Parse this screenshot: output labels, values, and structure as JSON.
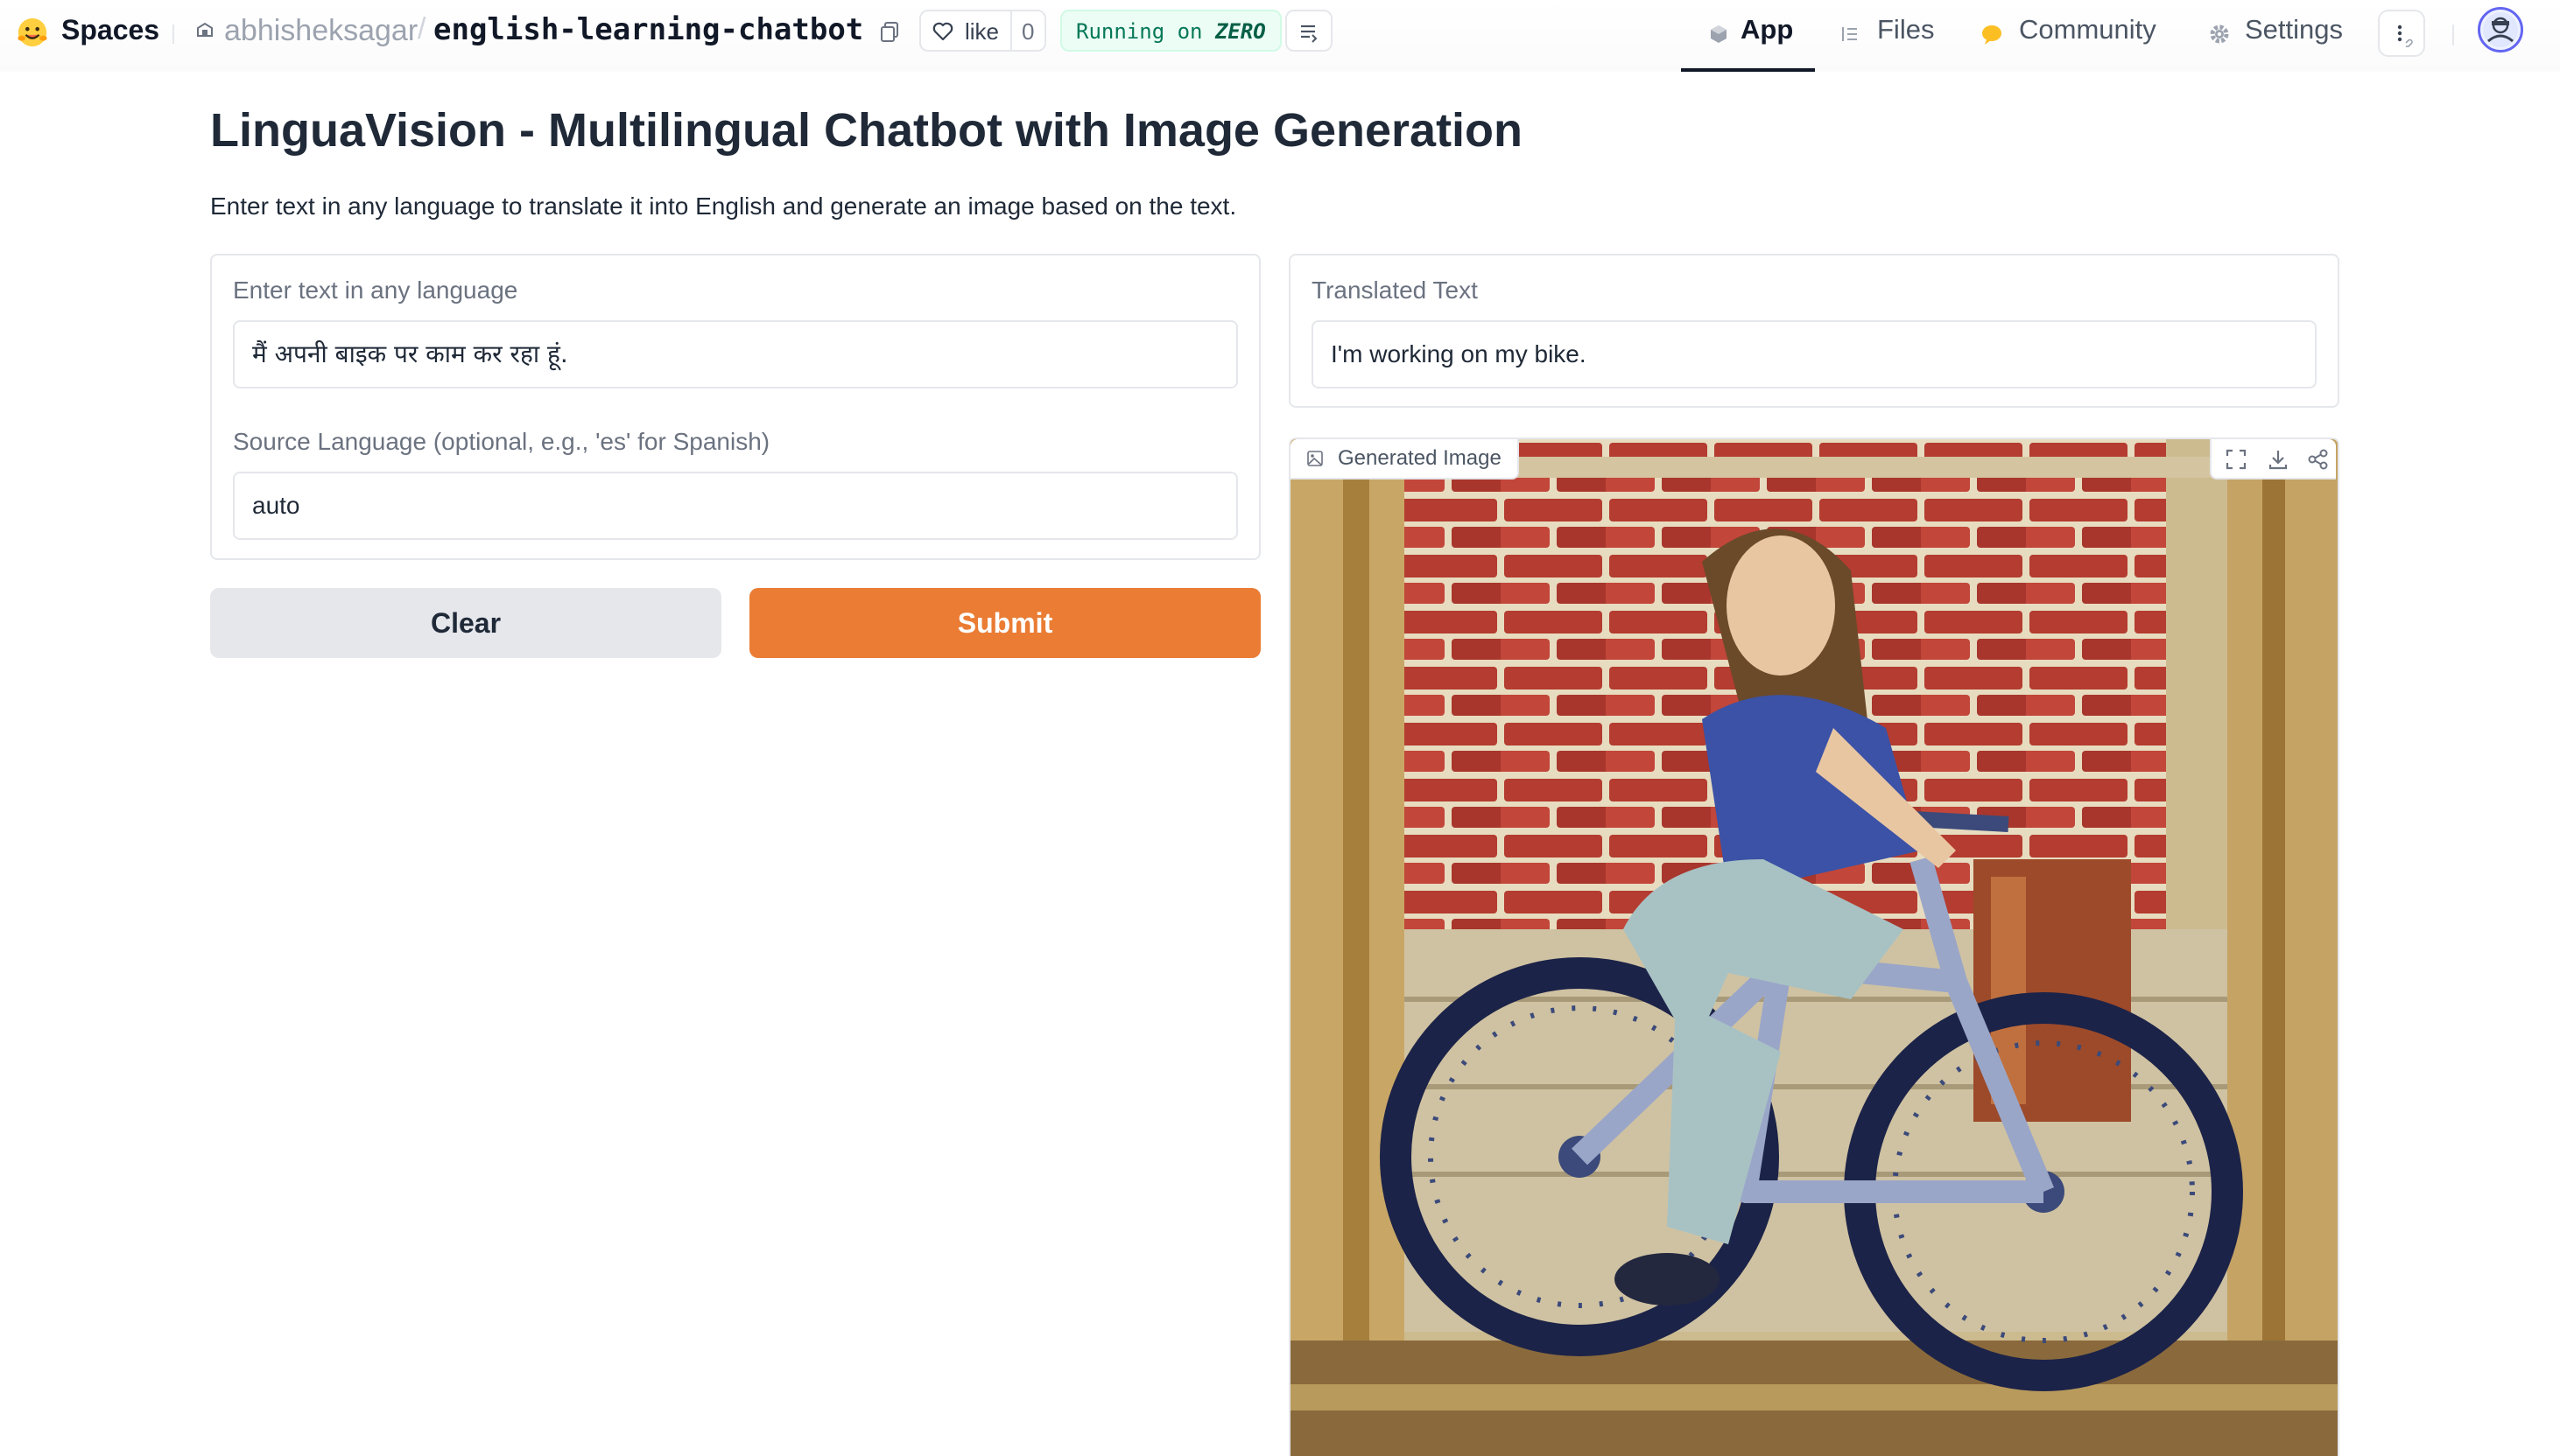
{
  "header": {
    "brand": "Spaces",
    "owner": "abhisheksagar",
    "separator": "/",
    "repo": "english-learning-chatbot",
    "like_label": "like",
    "like_count": "0",
    "running_prefix": "Running on",
    "running_hardware": "ZERO",
    "nav": [
      {
        "label": "App",
        "icon": "cube-icon",
        "active": true
      },
      {
        "label": "Files",
        "icon": "files-icon",
        "active": false
      },
      {
        "label": "Community",
        "icon": "community-icon",
        "active": false
      },
      {
        "label": "Settings",
        "icon": "gear-icon",
        "active": false
      }
    ]
  },
  "main": {
    "title": "LinguaVision - Multilingual Chatbot with Image Generation",
    "description": "Enter text in any language to translate it into English and generate an image based on the text.",
    "input_panel": {
      "text_label": "Enter text in any language",
      "text_value": "मैं अपनी बाइक पर काम कर रहा हूं.",
      "lang_label": "Source Language (optional, e.g., 'es' for Spanish)",
      "lang_value": "auto"
    },
    "buttons": {
      "clear": "Clear",
      "submit": "Submit"
    },
    "output_panel": {
      "translated_label": "Translated Text",
      "translated_value": "I'm working on my bike.",
      "image_label": "Generated Image"
    }
  },
  "colors": {
    "accent": "#ea7c34",
    "running_bg": "#ecfdf5",
    "running_text": "#047857"
  }
}
